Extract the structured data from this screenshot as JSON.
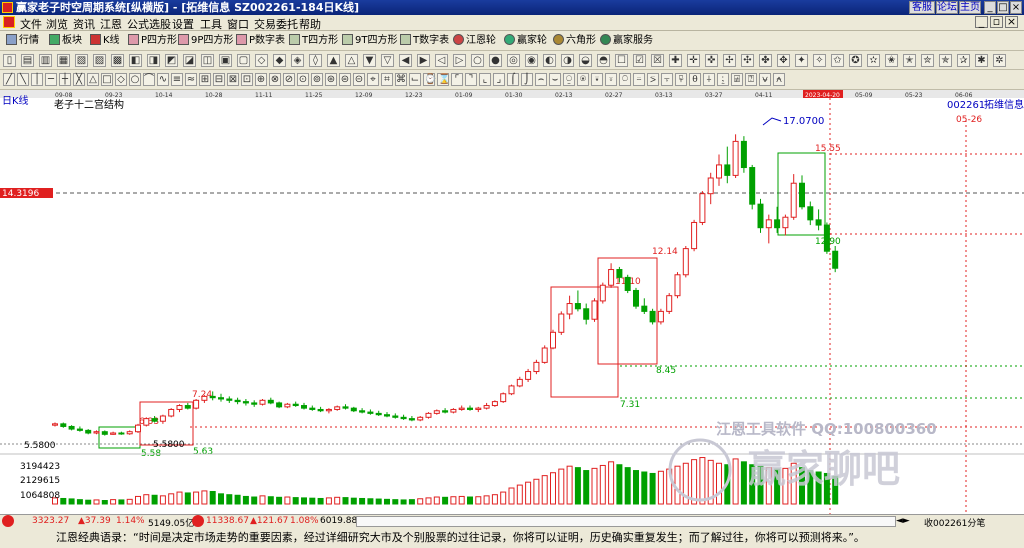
{
  "window": {
    "title": "赢家老子时空周期系统[纵横版] - [拓维信息  SZ002261-184日K线]",
    "buttons": [
      "客服",
      "论坛",
      "主页"
    ]
  },
  "menu": [
    "文件",
    "浏览",
    "资讯",
    "江恩",
    "公式选股",
    "设置",
    "工具",
    "窗口",
    "交易委托",
    "帮助"
  ],
  "toolbar1": [
    "行情",
    "板块",
    "K线",
    "P四方形",
    "9P四方形",
    "P数字表",
    "T四方形",
    "9T四方形",
    "T数字表",
    "江恩轮",
    "赢家轮",
    "六角形",
    "赢家服务"
  ],
  "chart": {
    "kline_label": "日K线",
    "structure_label": "老子十二宫结构",
    "stock_code": "002261",
    "stock_name": "拓维信息",
    "future_date": "05-26",
    "price_tag_left": "14.3196",
    "price_tag_low": "5.5800",
    "date_axis": [
      "09-08",
      "09-23",
      "10-14",
      "10-28",
      "11-11",
      "11-25",
      "12-09",
      "12-23",
      "01-09",
      "01-30",
      "02-13",
      "02-27",
      "03-13",
      "03-27",
      "04-11",
      "2023-04-20",
      "05-09",
      "05-23",
      "06-06"
    ],
    "price_labels": {
      "p17070": "17.0700",
      "p1555": "15.55",
      "p1290": "12.90",
      "p1214": "12.14",
      "p1110": "11.10",
      "p845": "8.45",
      "p731": "7.31",
      "p724": "7.24",
      "p633": "6.33",
      "p558a": "5.5800",
      "p558b": "5.58",
      "p563": "5.63"
    },
    "volume_axis": [
      "3194423",
      "2129615",
      "1064808"
    ],
    "watermark_line": "江恩工具软件  QQ:100800360",
    "watermark_big": "赢家聊吧"
  },
  "status": {
    "sh_index": "3323.27",
    "sh_change": "▲37.39",
    "sh_pct": "1.14%",
    "sh_amount": "5149.05亿",
    "sz_index": "11338.67",
    "sz_change": "▲121.67",
    "sz_pct": "1.08%",
    "sz_amount": "6019.88",
    "right_text": "收002261分笔"
  },
  "quote": "江恩经典语录：“时间是决定市场走势的重要因素，经过详细研究大市及个别股票的过往记录，你将可以证明，历史确实重复发生；而了解过往，你将可以预测将来。”。",
  "colors": {
    "up": "#e02020",
    "down": "#00a000",
    "ref_red": "#e02020",
    "title_blue": "#0a2478"
  },
  "chart_data": {
    "type": "candlestick",
    "symbol": "SZ002261",
    "name": "拓维信息",
    "ohlc": [
      [
        5.95,
        6.05,
        5.9,
        6.0
      ],
      [
        6.0,
        6.05,
        5.85,
        5.9
      ],
      [
        5.9,
        5.95,
        5.75,
        5.8
      ],
      [
        5.8,
        5.9,
        5.7,
        5.75
      ],
      [
        5.75,
        5.8,
        5.6,
        5.65
      ],
      [
        5.65,
        5.75,
        5.6,
        5.7
      ],
      [
        5.7,
        5.75,
        5.55,
        5.6
      ],
      [
        5.6,
        5.7,
        5.58,
        5.65
      ],
      [
        5.65,
        5.7,
        5.58,
        5.62
      ],
      [
        5.62,
        5.75,
        5.58,
        5.7
      ],
      [
        5.7,
        6.0,
        5.65,
        5.95
      ],
      [
        5.95,
        6.25,
        5.9,
        6.2
      ],
      [
        6.2,
        6.3,
        6.05,
        6.1
      ],
      [
        6.1,
        6.35,
        6.0,
        6.3
      ],
      [
        6.3,
        6.6,
        6.25,
        6.55
      ],
      [
        6.55,
        6.75,
        6.45,
        6.7
      ],
      [
        6.7,
        6.8,
        6.55,
        6.6
      ],
      [
        6.6,
        6.95,
        6.55,
        6.9
      ],
      [
        6.9,
        7.1,
        6.8,
        7.05
      ],
      [
        7.05,
        7.24,
        6.9,
        7.0
      ],
      [
        7.0,
        7.15,
        6.85,
        6.95
      ],
      [
        6.95,
        7.05,
        6.8,
        6.9
      ],
      [
        6.9,
        7.0,
        6.75,
        6.85
      ],
      [
        6.85,
        6.95,
        6.7,
        6.8
      ],
      [
        6.8,
        6.9,
        6.65,
        6.75
      ],
      [
        6.75,
        6.95,
        6.7,
        6.9
      ],
      [
        6.9,
        7.0,
        6.75,
        6.8
      ],
      [
        6.8,
        6.85,
        6.6,
        6.65
      ],
      [
        6.65,
        6.8,
        6.6,
        6.75
      ],
      [
        6.75,
        6.85,
        6.65,
        6.7
      ],
      [
        6.7,
        6.8,
        6.55,
        6.6
      ],
      [
        6.6,
        6.7,
        6.5,
        6.55
      ],
      [
        6.55,
        6.65,
        6.45,
        6.5
      ],
      [
        6.5,
        6.6,
        6.4,
        6.55
      ],
      [
        6.55,
        6.7,
        6.5,
        6.65
      ],
      [
        6.65,
        6.75,
        6.55,
        6.6
      ],
      [
        6.6,
        6.65,
        6.45,
        6.5
      ],
      [
        6.5,
        6.6,
        6.4,
        6.45
      ],
      [
        6.45,
        6.55,
        6.35,
        6.4
      ],
      [
        6.4,
        6.5,
        6.3,
        6.35
      ],
      [
        6.35,
        6.45,
        6.25,
        6.3
      ],
      [
        6.3,
        6.4,
        6.2,
        6.25
      ],
      [
        6.25,
        6.35,
        6.15,
        6.2
      ],
      [
        6.2,
        6.3,
        6.1,
        6.15
      ],
      [
        6.15,
        6.3,
        6.1,
        6.25
      ],
      [
        6.25,
        6.45,
        6.2,
        6.4
      ],
      [
        6.4,
        6.55,
        6.35,
        6.5
      ],
      [
        6.5,
        6.6,
        6.4,
        6.45
      ],
      [
        6.45,
        6.6,
        6.4,
        6.55
      ],
      [
        6.55,
        6.7,
        6.5,
        6.6
      ],
      [
        6.6,
        6.7,
        6.5,
        6.55
      ],
      [
        6.55,
        6.65,
        6.45,
        6.6
      ],
      [
        6.6,
        6.8,
        6.55,
        6.7
      ],
      [
        6.7,
        6.9,
        6.65,
        6.85
      ],
      [
        6.85,
        7.2,
        6.8,
        7.15
      ],
      [
        7.15,
        7.5,
        7.1,
        7.45
      ],
      [
        7.45,
        7.8,
        7.4,
        7.7
      ],
      [
        7.7,
        8.1,
        7.6,
        8.0
      ],
      [
        8.0,
        8.45,
        7.9,
        8.35
      ],
      [
        8.35,
        9.0,
        8.3,
        8.9
      ],
      [
        8.9,
        9.6,
        8.85,
        9.5
      ],
      [
        9.5,
        10.3,
        9.4,
        10.2
      ],
      [
        10.2,
        10.9,
        10.0,
        10.6
      ],
      [
        10.6,
        11.1,
        10.3,
        10.4
      ],
      [
        10.4,
        10.6,
        9.8,
        10.0
      ],
      [
        10.0,
        10.8,
        9.9,
        10.7
      ],
      [
        10.7,
        11.4,
        10.6,
        11.3
      ],
      [
        11.3,
        12.14,
        11.2,
        11.9
      ],
      [
        11.9,
        12.0,
        11.4,
        11.6
      ],
      [
        11.6,
        11.7,
        11.0,
        11.1
      ],
      [
        11.1,
        11.2,
        10.4,
        10.5
      ],
      [
        10.5,
        10.8,
        10.2,
        10.3
      ],
      [
        10.3,
        10.4,
        9.8,
        9.9
      ],
      [
        9.9,
        10.4,
        9.8,
        10.3
      ],
      [
        10.3,
        11.0,
        10.2,
        10.9
      ],
      [
        10.9,
        11.8,
        10.8,
        11.7
      ],
      [
        11.7,
        12.8,
        11.6,
        12.7
      ],
      [
        12.7,
        13.8,
        12.6,
        13.7
      ],
      [
        13.7,
        14.9,
        13.6,
        14.8
      ],
      [
        14.8,
        15.6,
        14.4,
        15.4
      ],
      [
        15.4,
        16.3,
        15.1,
        15.9
      ],
      [
        15.9,
        16.6,
        15.2,
        15.5
      ],
      [
        15.5,
        17.07,
        15.4,
        16.8
      ],
      [
        16.8,
        17.0,
        15.6,
        15.8
      ],
      [
        15.8,
        15.9,
        14.2,
        14.4
      ],
      [
        14.4,
        14.6,
        13.3,
        13.5
      ],
      [
        13.5,
        14.0,
        12.9,
        13.8
      ],
      [
        13.8,
        14.3,
        13.3,
        13.5
      ],
      [
        13.5,
        14.0,
        13.2,
        13.9
      ],
      [
        13.9,
        15.55,
        13.8,
        15.2
      ],
      [
        15.2,
        15.5,
        14.2,
        14.3
      ],
      [
        14.3,
        14.5,
        13.6,
        13.8
      ],
      [
        13.8,
        14.2,
        13.4,
        13.6
      ],
      [
        13.6,
        13.7,
        12.5,
        12.6
      ],
      [
        12.6,
        12.8,
        11.8,
        11.95
      ]
    ],
    "volume": [
      420,
      380,
      350,
      300,
      260,
      280,
      240,
      300,
      280,
      320,
      520,
      640,
      600,
      560,
      700,
      820,
      760,
      820,
      900,
      860,
      700,
      640,
      600,
      520,
      480,
      560,
      500,
      460,
      480,
      440,
      420,
      400,
      380,
      420,
      460,
      440,
      400,
      380,
      360,
      340,
      320,
      300,
      280,
      300,
      360,
      420,
      480,
      460,
      500,
      520,
      480,
      500,
      560,
      640,
      820,
      1100,
      1300,
      1500,
      1700,
      1950,
      2150,
      2400,
      2600,
      2500,
      2300,
      2450,
      2650,
      2900,
      2700,
      2500,
      2300,
      2200,
      2100,
      2250,
      2400,
      2600,
      2800,
      3050,
      3194,
      3000,
      2800,
      2700,
      3100,
      2900,
      2700,
      2600,
      2500,
      2400,
      2450,
      2800,
      2500,
      2300,
      2200,
      2100,
      1900
    ],
    "x_ticks": [
      "09-08",
      "09-23",
      "10-14",
      "10-28",
      "11-11",
      "11-25",
      "12-09",
      "12-23",
      "01-09",
      "01-30",
      "02-13",
      "02-27",
      "03-13",
      "03-27",
      "04-11",
      "2023-04-20",
      "05-09",
      "05-23",
      "06-06"
    ],
    "price_range": [
      5.0,
      18.0
    ],
    "volume_axis_labels": [
      3194423,
      2129615,
      1064808
    ],
    "reference_lines": [
      14.3196,
      5.58,
      8.45,
      7.31,
      12.9,
      15.55
    ]
  }
}
